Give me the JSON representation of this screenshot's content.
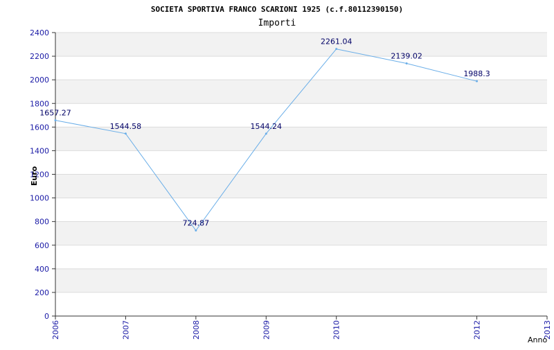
{
  "title": "SOCIETA SPORTIVA FRANCO SCARIONI 1925 (c.f.80112390150)",
  "subtitle": "Importi",
  "colors": {
    "band": "#f2f2f2",
    "grid": "#dcdcdc",
    "axis": "#333333",
    "tick_label": "#1a1aa6",
    "line": "#6aaee8",
    "data_label": "#000066",
    "title": "#222222"
  },
  "chart_data": {
    "type": "line",
    "title": "SOCIETA SPORTIVA FRANCO SCARIONI 1925 (c.f.80112390150)",
    "subtitle": "Importi",
    "xlabel": "Anno",
    "ylabel": "Euro",
    "ylim": [
      0,
      2400
    ],
    "yticks": [
      0,
      200,
      400,
      600,
      800,
      1000,
      1200,
      1400,
      1600,
      1800,
      2000,
      2200,
      2400
    ],
    "xlim": [
      2006,
      2013
    ],
    "xticks": [
      2006,
      2007,
      2008,
      2009,
      2010,
      2012,
      2013
    ],
    "grid": true,
    "series": [
      {
        "x": [
          2006,
          2007,
          2008,
          2009,
          2010,
          2011,
          2012
        ],
        "values": [
          1657.27,
          1544.58,
          724.87,
          1544.24,
          2261.04,
          2139.02,
          1988.3
        ],
        "labels": [
          "1657.27",
          "1544.58",
          "724.87",
          "1544.24",
          "2261.04",
          "2139.02",
          "1988.3"
        ]
      }
    ]
  }
}
